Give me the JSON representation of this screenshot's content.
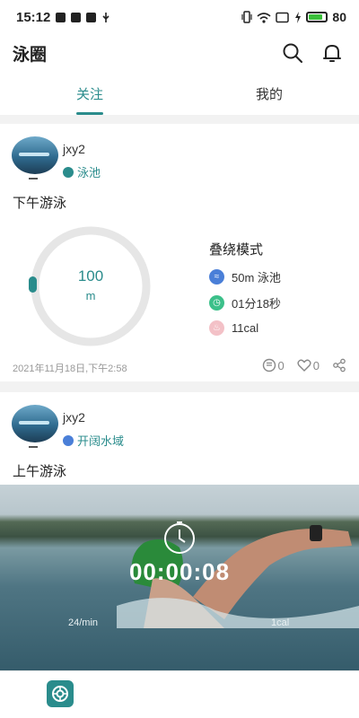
{
  "status_bar": {
    "time": "15:12",
    "battery": "80",
    "battery_level": 0.8
  },
  "app_bar": {
    "title": "泳圈"
  },
  "tabs": [
    {
      "label": "关注",
      "active": true
    },
    {
      "label": "我的",
      "active": false
    }
  ],
  "posts": [
    {
      "username": "jxy2",
      "location": "泳池",
      "title": "下午游泳",
      "distance_value": "100",
      "distance_unit": "m",
      "mode": "叠绕模式",
      "stats": [
        {
          "icon": "pool-icon",
          "text": "50m  泳池"
        },
        {
          "icon": "timer-icon",
          "text": "01分18秒"
        },
        {
          "icon": "flame-icon",
          "text": "11cal"
        }
      ],
      "timestamp": "2021年11月18日,下午2:58",
      "comments": "0",
      "likes": "0"
    },
    {
      "username": "jxy2",
      "location": "开阔水域",
      "title": "上午游泳",
      "overlay_time": "00:00:08",
      "overlay_left": "24/min",
      "overlay_right": "1cal"
    }
  ],
  "colors": {
    "accent": "#2a8c8c",
    "ring": "#e6e6e6"
  }
}
